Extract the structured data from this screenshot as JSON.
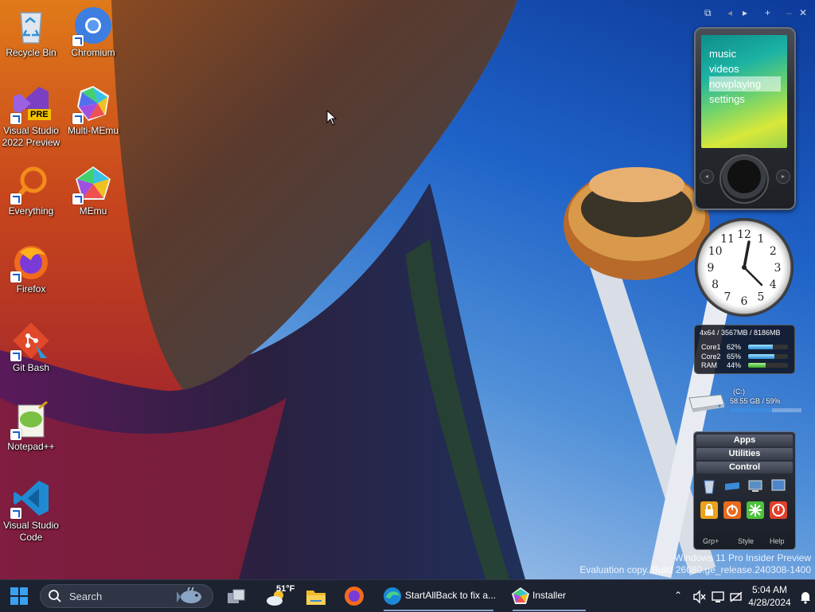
{
  "desktop_icons": [
    {
      "label": "Recycle Bin",
      "icon": "recycle-bin-icon"
    },
    {
      "label": "Chromium",
      "icon": "chromium-icon"
    },
    {
      "label": "Visual Studio\n2022 Preview",
      "icon": "visual-studio-icon",
      "badge": "PRE"
    },
    {
      "label": "Multi-MEmu",
      "icon": "multi-memu-icon"
    },
    {
      "label": "Everything",
      "icon": "everything-search-icon"
    },
    {
      "label": "MEmu",
      "icon": "memu-icon"
    },
    {
      "label": "Firefox",
      "icon": "firefox-icon"
    },
    {
      "label": "Git Bash",
      "icon": "git-bash-icon"
    },
    {
      "label": "Notepad++",
      "icon": "notepad-plus-plus-icon"
    },
    {
      "label": "Visual Studio\nCode",
      "icon": "vscode-icon"
    }
  ],
  "gadget_toolbar": {
    "icons": [
      "gadget-window-icon",
      "previous-arrow-icon",
      "next-arrow-icon",
      "add-icon",
      "minimize-icon",
      "close-icon"
    ]
  },
  "zune_gadget": {
    "menu": [
      "music",
      "videos",
      "nowplaying",
      "settings"
    ],
    "selected": "nowplaying"
  },
  "clock_gadget": {
    "numbers": [
      "12",
      "1",
      "2",
      "3",
      "4",
      "5",
      "6",
      "7",
      "8",
      "9",
      "10",
      "11"
    ]
  },
  "cpu_meter": {
    "header": "4x64 / 3567MB / 8186MB",
    "rows": [
      {
        "label": "Core1",
        "percent": "62%",
        "fill": 0.62
      },
      {
        "label": "Core2",
        "percent": "65%",
        "fill": 0.65
      },
      {
        "label": "RAM",
        "percent": "44%",
        "fill": 0.44
      }
    ]
  },
  "drive_meter": {
    "drive": "(C:)",
    "usage": "58.55 GB / 59%",
    "fill": 0.59
  },
  "launcher": {
    "groups": [
      "Apps",
      "Utilities",
      "Control"
    ],
    "footer": [
      "Grp+",
      "Style",
      "Help"
    ],
    "tile_colors": [
      "#4a7ec0",
      "#3b8ad8",
      "#5a8fc4",
      "#4d86c8",
      "#e8a21c",
      "#e86b1c",
      "#4cc23a",
      "#e0402a"
    ]
  },
  "watermark": {
    "line1": "Windows 11 Pro Insider Preview",
    "line2": "Evaluation copy. Build 26080.ge_release.240308-1400"
  },
  "taskbar": {
    "search_placeholder": "Search",
    "weather": "51°F",
    "apps": [
      {
        "label": "StartAllBack to fix a...",
        "icon": "edge-icon"
      },
      {
        "label": "Installer",
        "icon": "memu-installer-icon"
      }
    ],
    "time": "5:04 AM",
    "date": "4/28/2024"
  },
  "colors": {
    "taskbar_bg": "#1c2230",
    "accent": "#2a8cd6"
  }
}
